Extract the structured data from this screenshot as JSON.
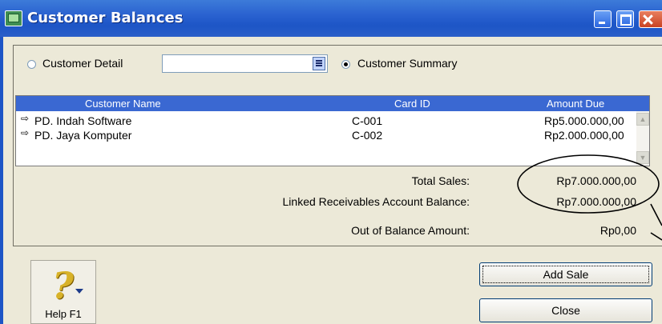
{
  "window": {
    "title": "Customer Balances"
  },
  "view_options": {
    "detail_label": "Customer Detail",
    "detail_mnemonic": "D",
    "detail_selected": false,
    "customer_select_value": "",
    "summary_label": "Customer Summary",
    "summary_mnemonic": "u",
    "summary_selected": true
  },
  "table": {
    "columns": [
      "Customer Name",
      "Card ID",
      "Amount Due"
    ],
    "rows": [
      {
        "name": "PD. Indah Software",
        "card_id": "C-001",
        "amount": "Rp5.000.000,00"
      },
      {
        "name": "PD. Jaya Komputer",
        "card_id": "C-002",
        "amount": "Rp2.000.000,00"
      }
    ]
  },
  "totals": {
    "total_sales_label": "Total Sales:",
    "total_sales_value": "Rp7.000.000,00",
    "linked_label": "Linked Receivables Account Balance:",
    "linked_value": "Rp7.000.000,00",
    "out_of_balance_label": "Out of Balance Amount:",
    "out_of_balance_value": "Rp0,00"
  },
  "buttons": {
    "help_label": "Help F1",
    "add_sale_label": "Add Sale",
    "close_label": "Close"
  },
  "colors": {
    "titlebar": "#2a62d0",
    "grid_header": "#3a68d2",
    "annotation": "#000000"
  }
}
